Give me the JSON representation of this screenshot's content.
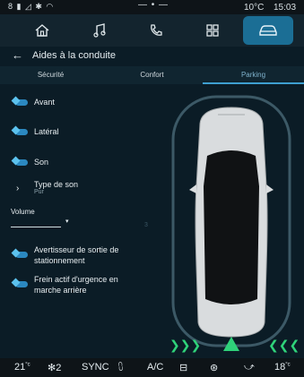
{
  "status": {
    "signal_icons": "8 ▮ ◿ ✱ ◠",
    "middle_dots": "— • —",
    "temperature": "10°C",
    "time": "15:03"
  },
  "topnav": [
    {
      "name": "home-icon"
    },
    {
      "name": "music-icon"
    },
    {
      "name": "phone-icon"
    },
    {
      "name": "apps-icon"
    },
    {
      "name": "car-icon",
      "active": true
    }
  ],
  "header": {
    "back_icon": "←",
    "title": "Aides à la conduite"
  },
  "tabs": [
    {
      "label": "Sécurité"
    },
    {
      "label": "Confort"
    },
    {
      "label": "Parking",
      "active": true
    }
  ],
  "settings": {
    "avant": "Avant",
    "lateral": "Latéral",
    "son": "Son",
    "type_de_son": "Type de son",
    "type_de_son_value": "Pur",
    "volume": "Volume",
    "volume_value": "3",
    "avertisseur_line1": "Avertisseur de sortie de",
    "avertisseur_line2": "stationnement",
    "frein_line1": "Frein actif d'urgence en",
    "frein_line2": "marche arrière"
  },
  "parking": {
    "left_arrows": "❯❯❯",
    "right_arrows": "❮❮❮"
  },
  "bottombar": {
    "temp_left": "21",
    "temp_left_unit": "°c",
    "fan_speed": "2",
    "sync": "SYNC",
    "ac": "A/C",
    "temp_right": "18",
    "temp_right_unit": "°c"
  },
  "colors": {
    "accent": "#2b88c0",
    "active_tab": "#1b6e95",
    "background": "#0b1c26",
    "sensor_green": "#2fd27a"
  }
}
